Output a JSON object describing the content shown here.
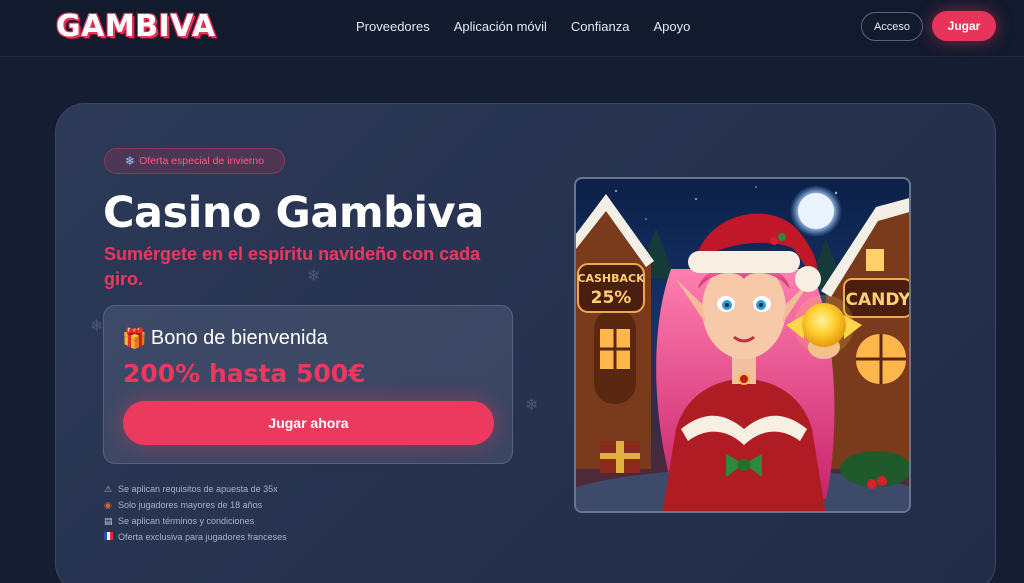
{
  "brand": {
    "logo_text": "GAMBIVA"
  },
  "nav": {
    "items": [
      {
        "label": "Proveedores"
      },
      {
        "label": "Aplicación móvil"
      },
      {
        "label": "Confianza"
      },
      {
        "label": "Apoyo"
      }
    ],
    "access_label": "Acceso",
    "play_label": "Jugar"
  },
  "hero": {
    "badge": "Oferta especial de invierno",
    "title": "Casino Gambiva",
    "subtitle": "Sumérgete en el espíritu navideño con cada giro.",
    "bonus_title": "Bono de bienvenida",
    "bonus_amount": "200% hasta 500€",
    "cta_label": "Jugar ahora",
    "notes": [
      {
        "icon": "warning-icon",
        "text": "Se aplican requisitos de apuesta de 35x"
      },
      {
        "icon": "adult-icon",
        "text": "Solo jugadores mayores de 18 años"
      },
      {
        "icon": "document-icon",
        "text": "Se aplican términos y condiciones"
      },
      {
        "icon": "france-flag-icon",
        "text": "Oferta exclusiva para jugadores franceses"
      }
    ],
    "art": {
      "sign_left_line1": "CASHBACK",
      "sign_left_line2": "25%",
      "sign_right": "CANDY"
    }
  },
  "colors": {
    "accent": "#e8345a",
    "background": "#151d33",
    "card": "#2a3654"
  }
}
